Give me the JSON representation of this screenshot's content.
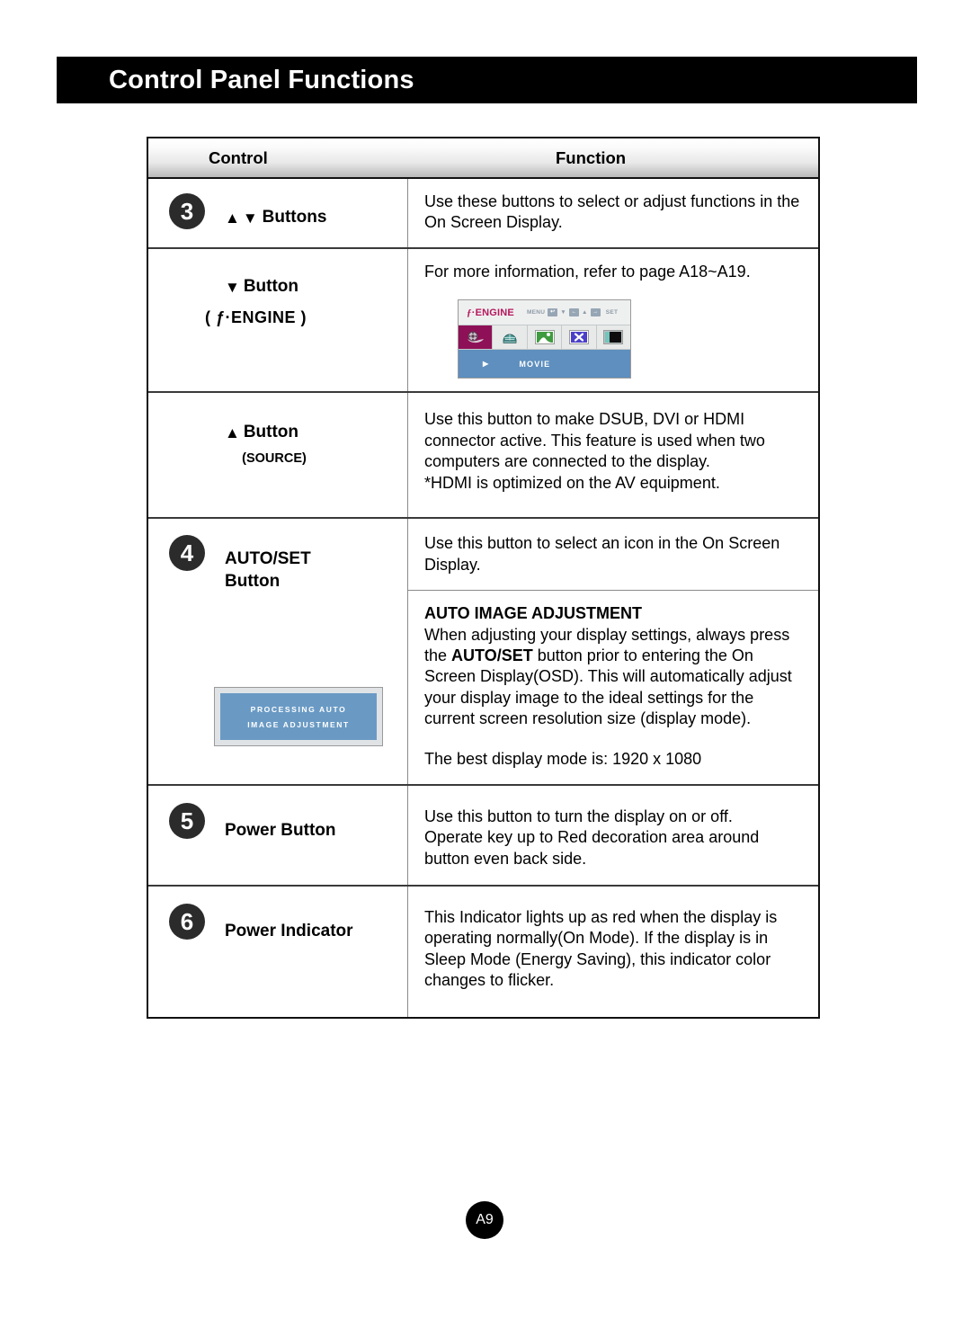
{
  "page": {
    "title": "Control Panel Functions",
    "page_number": "A9"
  },
  "table": {
    "headers": {
      "control": "Control",
      "function": "Function"
    },
    "rows": [
      {
        "step": "3",
        "control_label": "Buttons",
        "control_prefix_icons": "up-down-triangles",
        "function_text": "Use these buttons to select or adjust functions in the On Screen Display."
      },
      {
        "control_label": "Button",
        "control_prefix_icons": "down-triangle",
        "control_sub": "( ƒ·ENGINE )",
        "function_text": "For more information, refer to page A18~A19.",
        "osd": {
          "brand_f": "ƒ",
          "brand_rest": "·ENGINE",
          "hint_menu": "MENU",
          "hint_key_menu": "↩",
          "hint_down": "▼",
          "hint_key_down": "←",
          "hint_up": "▲",
          "hint_key_up": "→",
          "hint_set": "SET",
          "icons": [
            "film-reel-icon",
            "globe-icon",
            "photo-icon",
            "cross-icon",
            "contrast-icon"
          ],
          "play_glyph": "▶",
          "mode_label": "MOVIE"
        }
      },
      {
        "control_label": "Button",
        "control_prefix_icons": "up-triangle",
        "control_sub": "(SOURCE)",
        "function_lines": [
          "Use this button to make DSUB, DVI or HDMI",
          "connector active. This feature is used when two",
          "computers are connected to the display.",
          "*HDMI is optimized on the AV equipment."
        ]
      },
      {
        "step": "4",
        "control_label_line1": "AUTO/SET",
        "control_label_line2": "Button",
        "function_top": "Use this button to select an icon in the On Screen Display.",
        "function_heading": "AUTO IMAGE ADJUSTMENT",
        "function_body_part1": "When adjusting your display settings, always press the ",
        "function_body_bold": "AUTO/SET",
        "function_body_part2": " button prior to entering the On Screen Display(OSD). This will automatically adjust your display image to the ideal settings for the current screen resolution size (display mode).",
        "function_body_last": "The best display mode is: 1920 x 1080",
        "processing_box": {
          "line1": "PROCESSING AUTO",
          "line2": "IMAGE ADJUSTMENT"
        }
      },
      {
        "step": "5",
        "control_label": "Power Button",
        "function_lines": [
          "Use this button to turn the display on or off.",
          "Operate key up to Red decoration area around",
          "button even back side."
        ]
      },
      {
        "step": "6",
        "control_label": "Power Indicator",
        "function_lines": [
          "This Indicator lights up as red when the display is",
          "operating normally(On Mode). If the display is in",
          "Sleep Mode (Energy Saving), this indicator color",
          "changes to flicker."
        ]
      }
    ]
  },
  "colors": {
    "title_bar": "#000000",
    "osd_selected": "#8e1057",
    "osd_bar": "#5e8fbe",
    "osd_brand": "#b5185f",
    "processing_inner": "#6a9ac4",
    "step_circle": "#2b2b2b"
  }
}
